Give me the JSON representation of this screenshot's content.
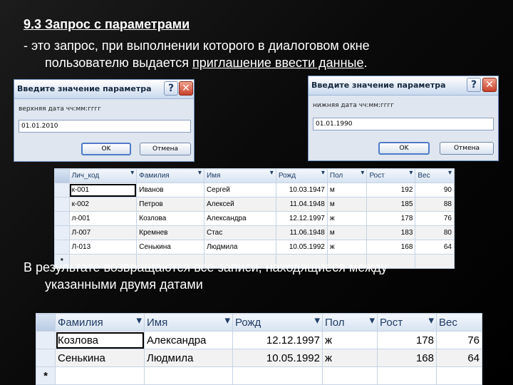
{
  "slide": {
    "heading": "9.3 Запрос с параметрами ",
    "para1_prefix": "- это запрос, при выполнении которого в диалоговом окне",
    "para1_line2": "пользователю выдается ",
    "para1_link": "приглашение ввести данные",
    "para1_end": ".",
    "para2_line1": "В результате возвращаются  все записи, находящиеся между",
    "para2_line2": "указанными двумя датами"
  },
  "dialogs": [
    {
      "title": "Введите значение параметра",
      "help": "?",
      "close": "✕",
      "label": "верхняя дата чч:мм:гггг",
      "value": "01.01.2010",
      "ok": "OK",
      "cancel": "Отмена"
    },
    {
      "title": "Введите значение параметра",
      "help": "?",
      "close": "✕",
      "label": "нижняя дата чч:мм:гггг",
      "value": "01.01.1990",
      "ok": "OK",
      "cancel": "Отмена"
    }
  ],
  "table1": {
    "headers": [
      "Лич_код",
      "Фамилия",
      "Имя",
      "Рожд",
      "Пол",
      "Рост",
      "Вес"
    ],
    "rows": [
      [
        "к-001",
        "Иванов",
        "Сергей",
        "10.03.1947",
        "м",
        "192",
        "90"
      ],
      [
        "к-002",
        "Петров",
        "Алексей",
        "11.04.1948",
        "м",
        "185",
        "88"
      ],
      [
        "л-001",
        "Козлова",
        "Александра",
        "12.12.1997",
        "ж",
        "178",
        "76"
      ],
      [
        "Л-007",
        "Кремнев",
        "Стас",
        "11.06.1948",
        "м",
        "183",
        "80"
      ],
      [
        "Л-013",
        "Сенькина",
        "Людмила",
        "10.05.1992",
        "ж",
        "168",
        "64"
      ]
    ],
    "new_row": "*"
  },
  "table2": {
    "headers": [
      "Фамилия",
      "Имя",
      "Рожд",
      "Пол",
      "Рост",
      "Вес"
    ],
    "rows": [
      [
        "Козлова",
        "Александра",
        "12.12.1997",
        "ж",
        "178",
        "76"
      ],
      [
        "Сенькина",
        "Людмила",
        "10.05.1992",
        "ж",
        "168",
        "64"
      ]
    ],
    "new_row": "*"
  },
  "icons": {
    "dropdown": "▾"
  }
}
